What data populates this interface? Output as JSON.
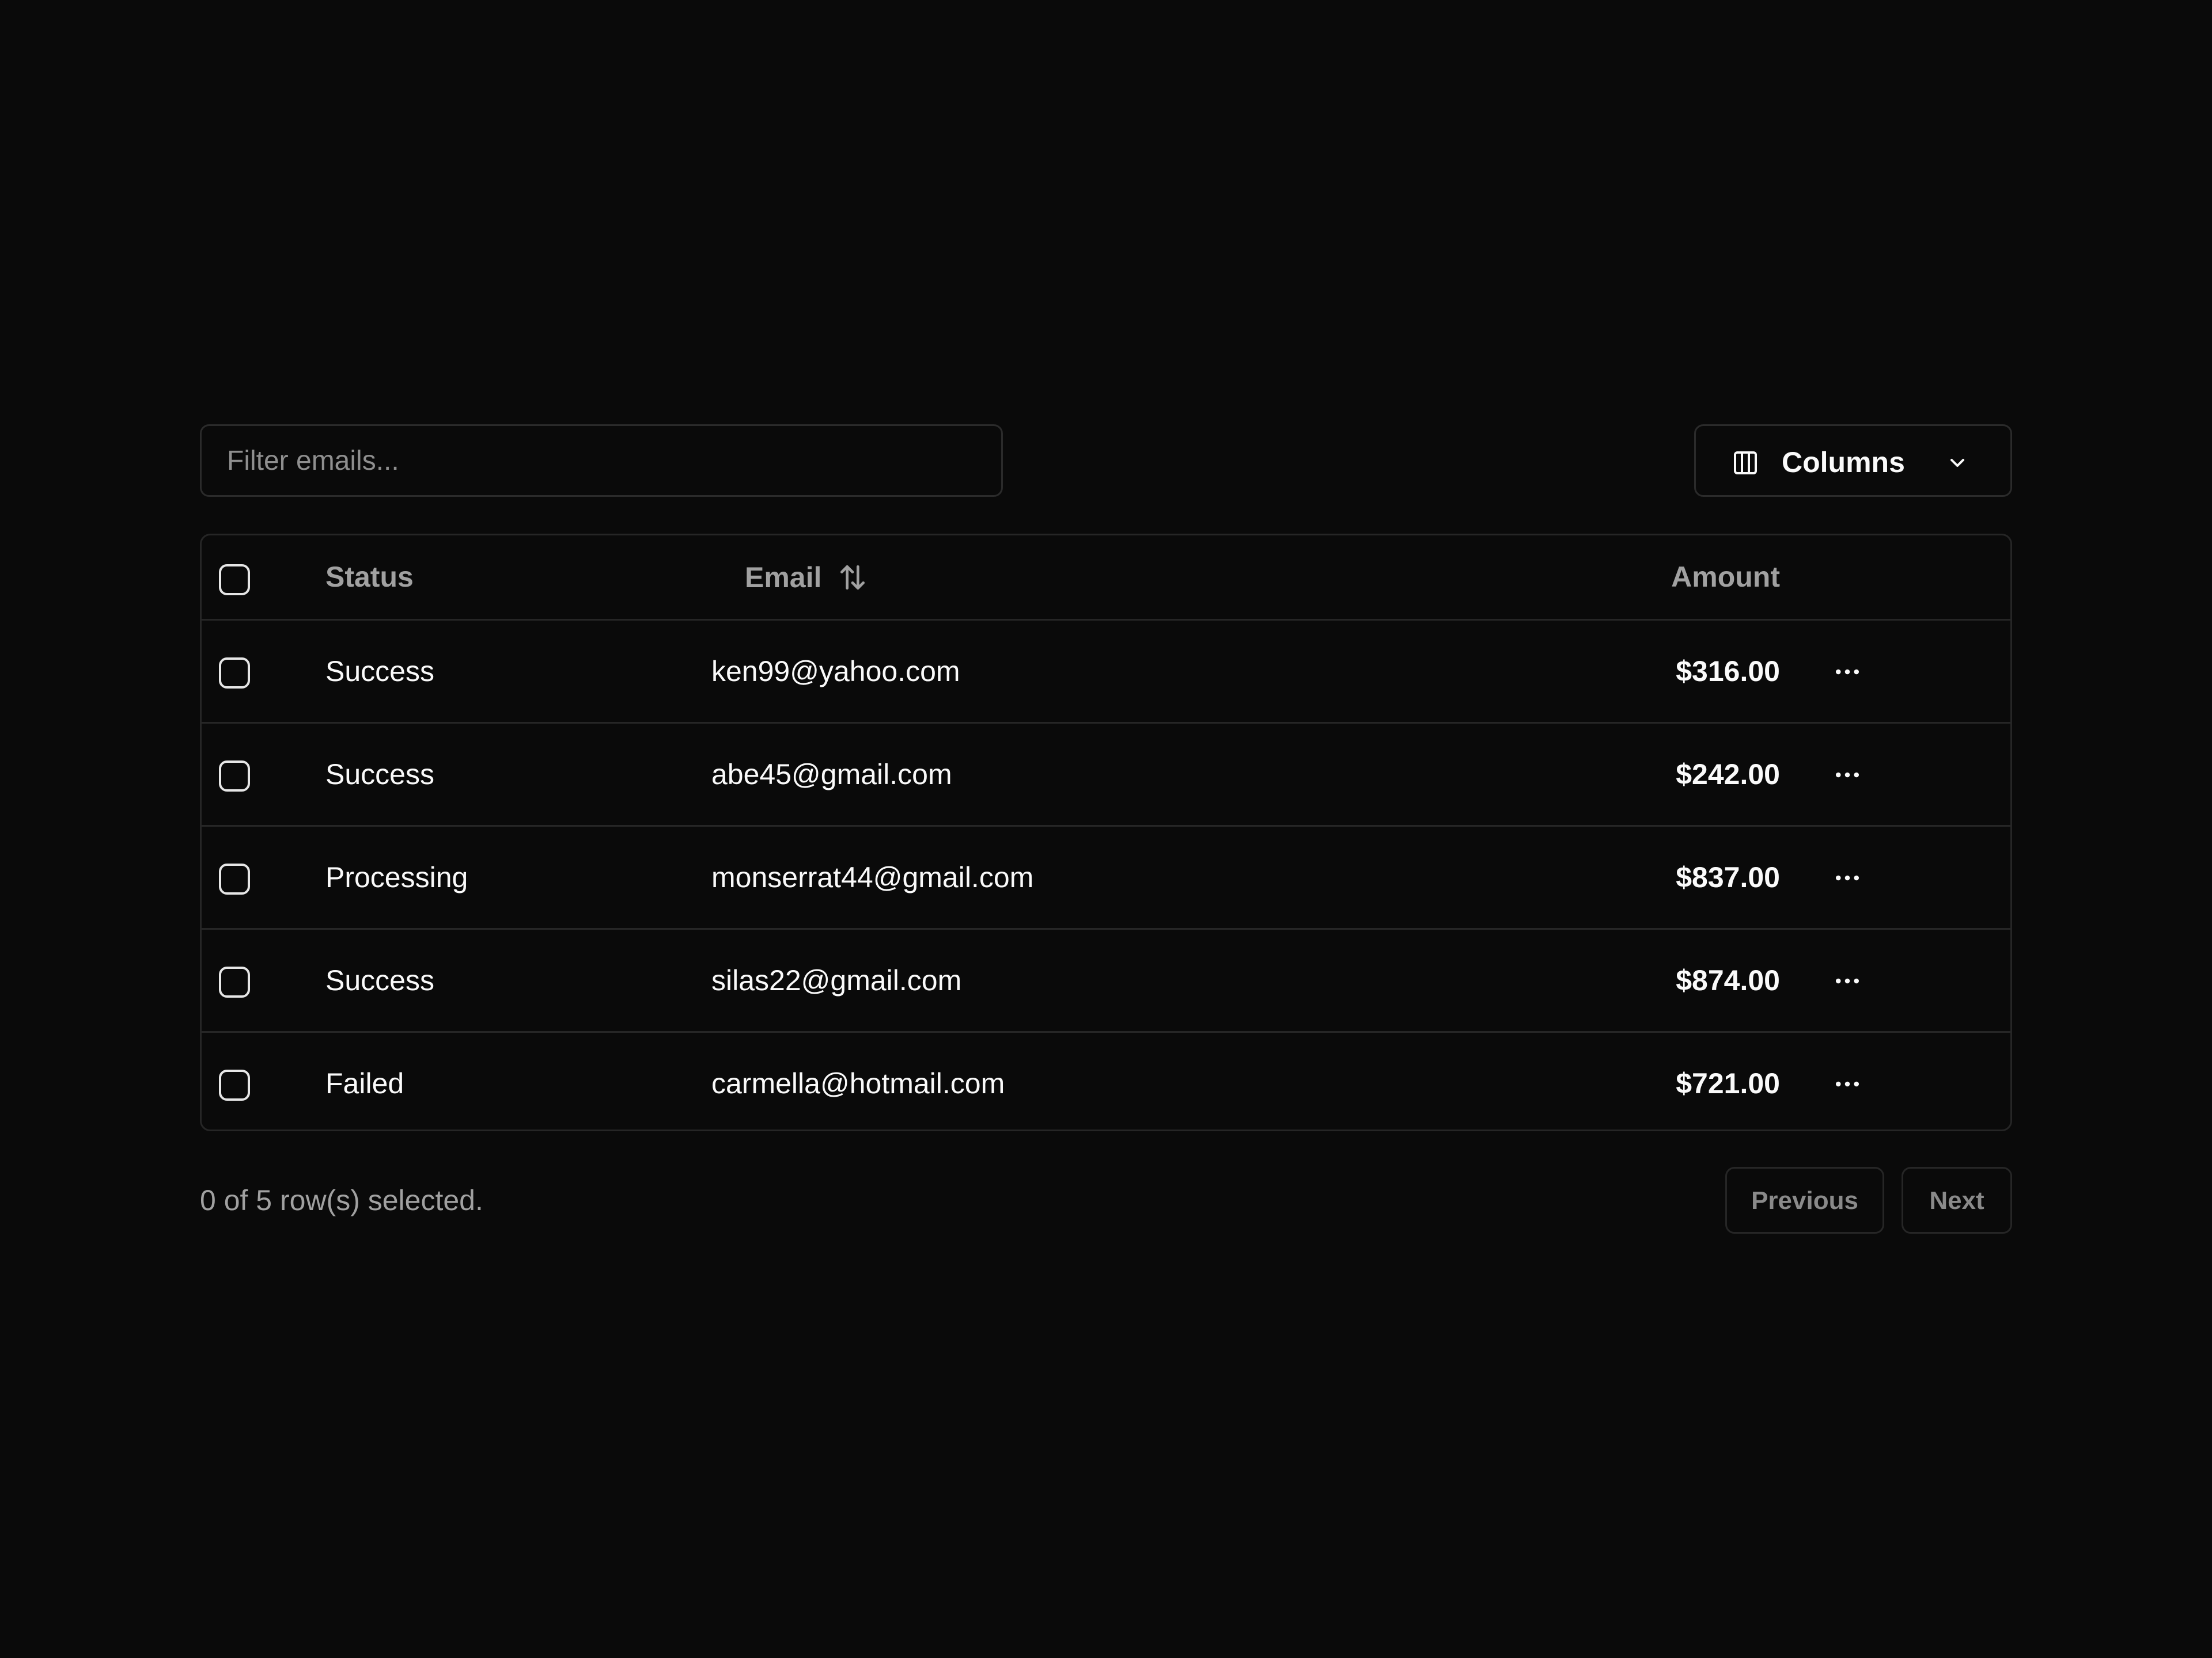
{
  "filter": {
    "placeholder": "Filter emails..."
  },
  "columns_button": {
    "label": "Columns",
    "icon": "columns-icon",
    "chevron": "chevron-down-icon"
  },
  "table": {
    "headers": {
      "status": "Status",
      "email": "Email",
      "amount": "Amount"
    },
    "rows": [
      {
        "status": "Success",
        "email": "ken99@yahoo.com",
        "amount": "$316.00"
      },
      {
        "status": "Success",
        "email": "abe45@gmail.com",
        "amount": "$242.00"
      },
      {
        "status": "Processing",
        "email": "monserrat44@gmail.com",
        "amount": "$837.00"
      },
      {
        "status": "Success",
        "email": "silas22@gmail.com",
        "amount": "$874.00"
      },
      {
        "status": "Failed",
        "email": "carmella@hotmail.com",
        "amount": "$721.00"
      }
    ]
  },
  "footer": {
    "selection_text": "0 of 5 row(s) selected.",
    "previous_label": "Previous",
    "next_label": "Next"
  },
  "colors": {
    "background": "#0a0a0a",
    "border": "#262626",
    "text": "#fafafa",
    "muted": "#a1a1a1"
  }
}
